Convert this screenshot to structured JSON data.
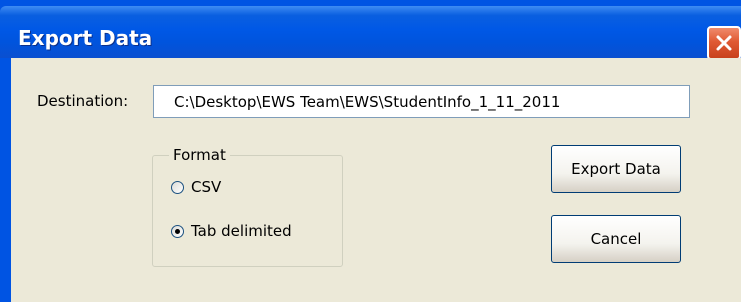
{
  "window": {
    "title": "Export Data",
    "close_icon": "close-icon"
  },
  "destination": {
    "label": "Destination:",
    "value": "C:\\Desktop\\EWS Team\\EWS\\StudentInfo_1_11_2011"
  },
  "format": {
    "legend": "Format",
    "options": [
      {
        "label": "CSV",
        "selected": false
      },
      {
        "label": "Tab delimited",
        "selected": true
      }
    ]
  },
  "buttons": {
    "export_label": "Export Data",
    "cancel_label": "Cancel"
  },
  "colors": {
    "titlebar": "#0054e3",
    "dialog_bg": "#ece9d8",
    "close_red": "#e05a34"
  }
}
